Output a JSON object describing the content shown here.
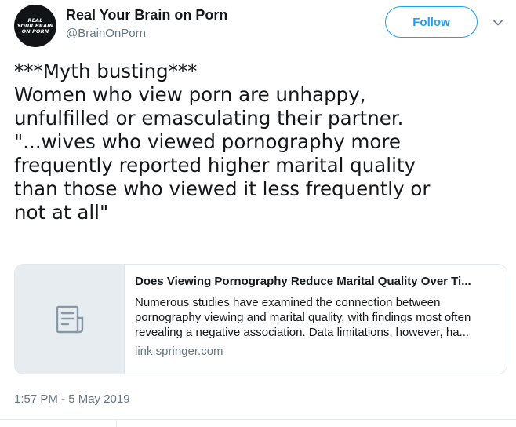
{
  "author": {
    "avatar_lines": [
      "REAL",
      "YOUR BRAIN",
      "ON PORN"
    ],
    "display_name": "Real Your Brain on Porn",
    "handle": "@BrainOnPorn"
  },
  "follow_label": "Follow",
  "tweet": {
    "lines": [
      "***Myth busting***",
      "Women who view porn are unhappy,",
      "unfulfilled or emasculating their partner.",
      "\"...wives who viewed pornography more",
      "frequently reported higher marital quality",
      "than those who viewed it less frequently or",
      "not at all\""
    ]
  },
  "card": {
    "icon": "document-icon",
    "title": "Does Viewing Pornography Reduce Marital Quality Over Ti...",
    "description_lines": [
      "Numerous studies have examined the connection between",
      "pornography viewing and marital quality, with findings most often",
      "revealing a negative association. Data limitations, however, ha..."
    ],
    "domain": "link.springer.com"
  },
  "timestamp": "1:57 PM - 5 May 2019",
  "colors": {
    "accent": "#1da1f2",
    "secondary_text": "#657786",
    "card_thumb_bg": "#e6ecf0"
  }
}
